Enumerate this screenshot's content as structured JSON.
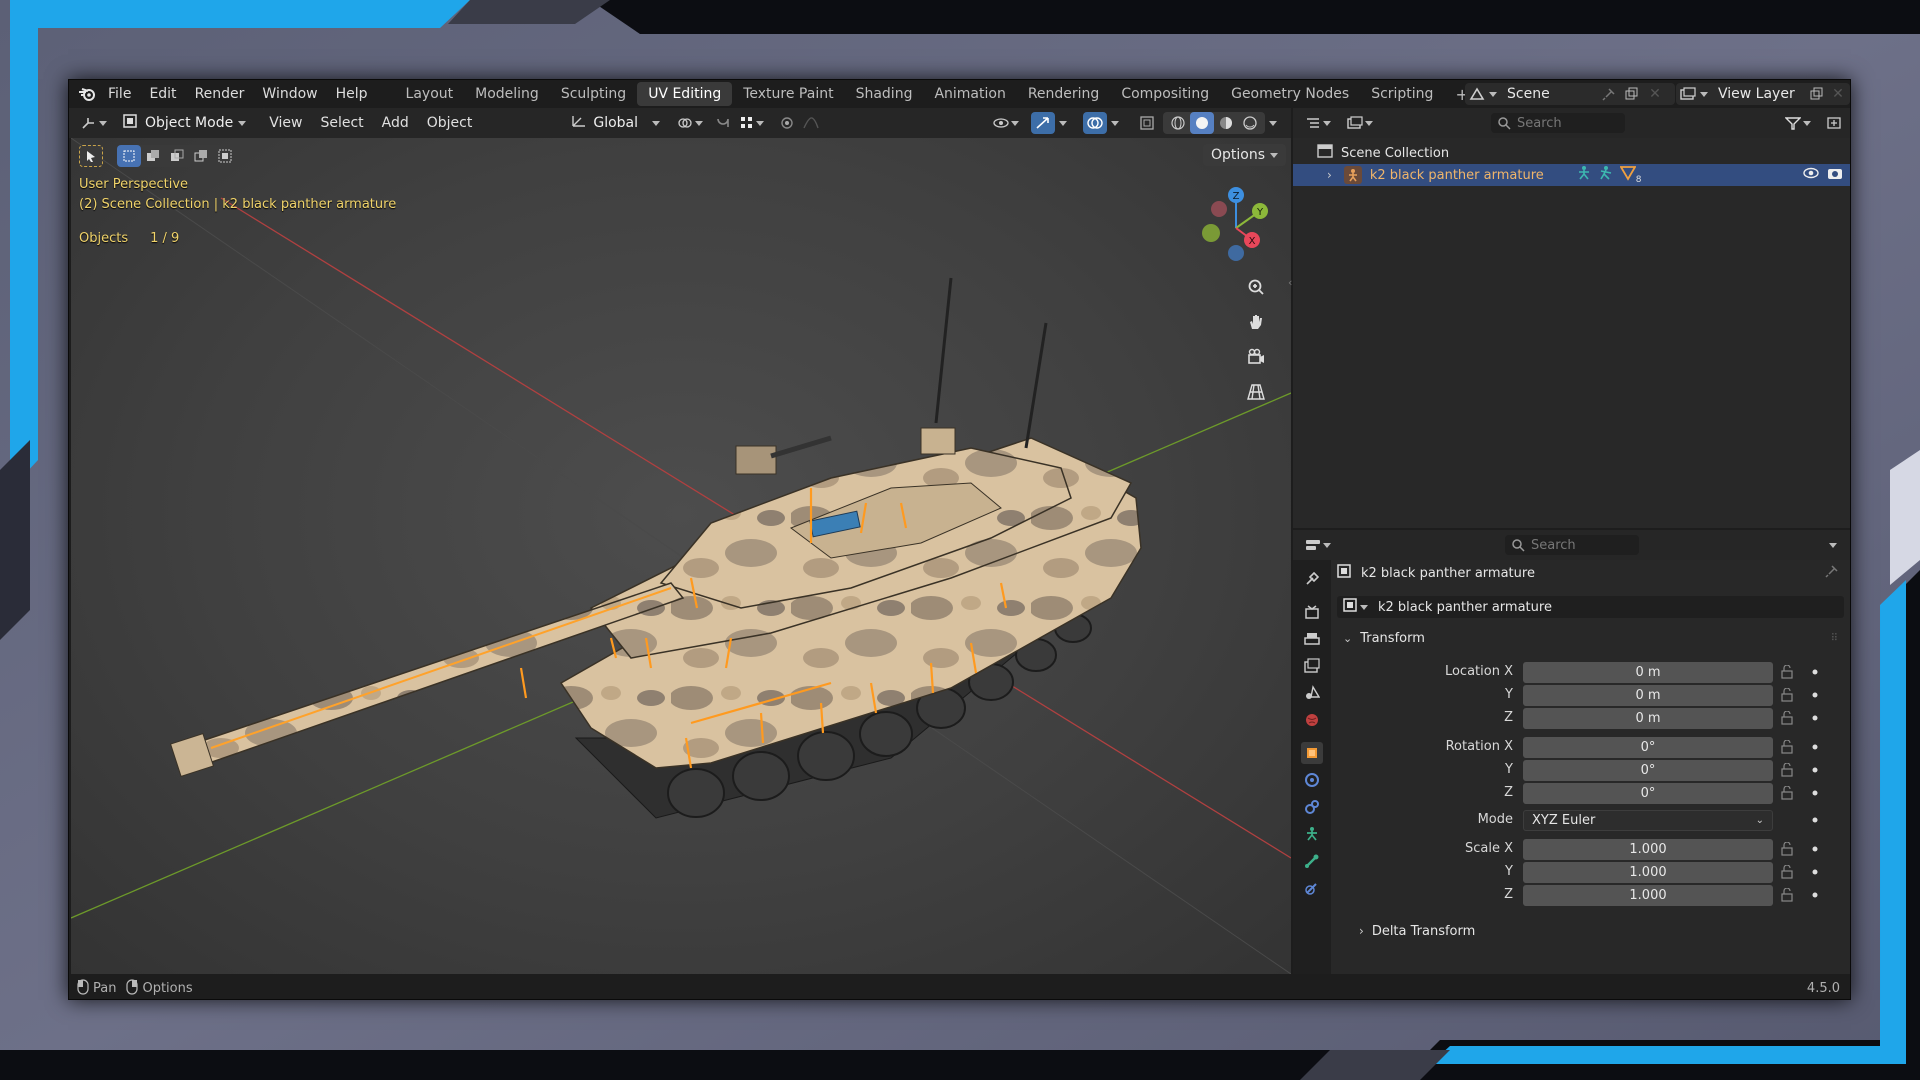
{
  "menu": [
    "File",
    "Edit",
    "Render",
    "Window",
    "Help"
  ],
  "workspaces": [
    "Layout",
    "Modeling",
    "Sculpting",
    "UV Editing",
    "Texture Paint",
    "Shading",
    "Animation",
    "Rendering",
    "Compositing",
    "Geometry Nodes",
    "Scripting"
  ],
  "active_workspace": "UV Editing",
  "scene_name": "Scene",
  "view_layer": "View Layer",
  "viewport_header": {
    "mode": "Object Mode",
    "menus": [
      "View",
      "Select",
      "Add",
      "Object"
    ],
    "orientation": "Global",
    "options": "Options"
  },
  "overlay": {
    "perspective": "User Perspective",
    "collection_path": "(2) Scene Collection | k2 black panther armature",
    "objects_label": "Objects",
    "objects_count": "1 / 9"
  },
  "gizmo_axes": {
    "x": "X",
    "y": "Y",
    "z": "Z"
  },
  "outliner": {
    "search_placeholder": "Search",
    "root": "Scene Collection",
    "item": "k2 black panther armature",
    "item_badge": "8"
  },
  "properties": {
    "search_placeholder": "Search",
    "object_name": "k2 black panther armature",
    "data_name": "k2 black panther armature",
    "panel": "Transform",
    "location_label": "Location X",
    "rotation_label": "Rotation X",
    "scale_label": "Scale X",
    "axis_y": "Y",
    "axis_z": "Z",
    "location": [
      "0 m",
      "0 m",
      "0 m"
    ],
    "rotation": [
      "0°",
      "0°",
      "0°"
    ],
    "mode_label": "Mode",
    "mode_value": "XYZ Euler",
    "scale": [
      "1.000",
      "1.000",
      "1.000"
    ],
    "delta": "Delta Transform"
  },
  "status": {
    "pan": "Pan",
    "options": "Options",
    "version": "4.5.0"
  },
  "colors": {
    "accent_blue": "#1fa6ea",
    "selection": "#334d80",
    "overlay_yellow": "#f0d36a",
    "x_axis": "#e8475a",
    "y_axis": "#8cb83a",
    "z_axis": "#3d8fe0"
  }
}
